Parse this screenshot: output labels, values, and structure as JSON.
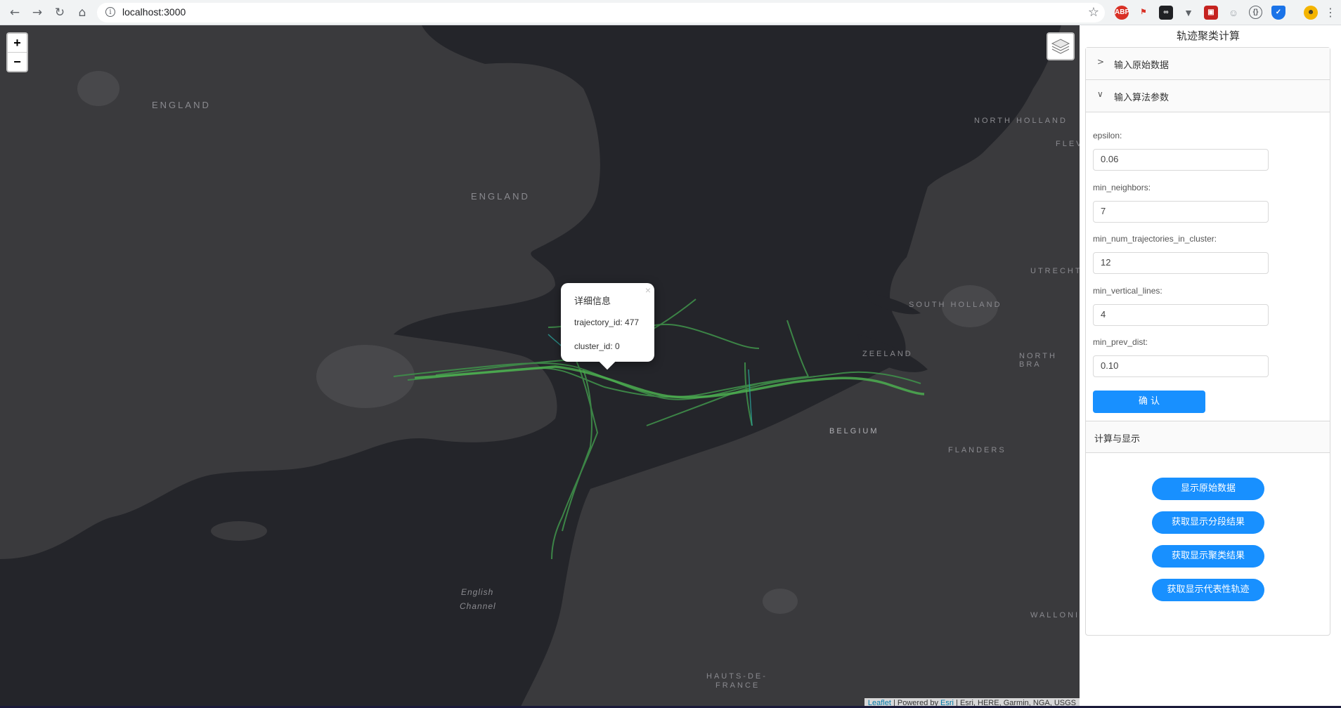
{
  "browser": {
    "url": "localhost:3000",
    "back_icon": "arrow-left",
    "forward_icon": "arrow-right",
    "reload_icon": "reload",
    "home_icon": "home"
  },
  "map": {
    "zoom_in": "+",
    "zoom_out": "−",
    "labels": {
      "england_top": "ENGLAND",
      "england": "ENGLAND",
      "north_holland": "NORTH HOLLAND",
      "flev": "FLEV",
      "utrecht": "UTRECHT",
      "south_holland": "SOUTH HOLLAND",
      "zeeland": "ZEELAND",
      "north_bra": "NORTH BRA",
      "belgium": "BELGIUM",
      "flanders": "FLANDERS",
      "wallonia": "WALLONIA",
      "english_channel_1": "English",
      "english_channel_2": "Channel",
      "hauts_1": "HAUTS-DE-",
      "hauts_2": "FRANCE"
    },
    "popup": {
      "title": "详细信息",
      "close": "×",
      "trajectory_id": "trajectory_id: 477",
      "cluster_id": "cluster_id: 0"
    },
    "attribution": {
      "leaflet": "Leaflet",
      "powered": " | Powered by ",
      "esri": "Esri",
      "rest": " | Esri, HERE, Garmin, NGA, USGS"
    },
    "colors": {
      "water": "#24252a",
      "land": "#3a3a3d",
      "trajectory": "#3f8f4a"
    }
  },
  "panel": {
    "title": "轨迹聚类计算",
    "sections": {
      "raw_data": "输入原始数据",
      "algo_params": "输入算法参数",
      "compute": "计算与显示"
    },
    "fields": {
      "epsilon_label": "epsilon:",
      "epsilon_value": "0.06",
      "min_neighbors_label": "min_neighbors:",
      "min_neighbors_value": "7",
      "min_num_traj_label": "min_num_trajectories_in_cluster:",
      "min_num_traj_value": "12",
      "min_vertical_label": "min_vertical_lines:",
      "min_vertical_value": "4",
      "min_prev_label": "min_prev_dist:",
      "min_prev_value": "0.10"
    },
    "confirm": "确 认",
    "actions": {
      "show_raw": "显示原始数据",
      "show_segments": "获取显示分段结果",
      "show_clusters": "获取显示聚类结果",
      "show_representative": "获取显示代表性轨迹"
    },
    "accent": "#1890ff"
  }
}
